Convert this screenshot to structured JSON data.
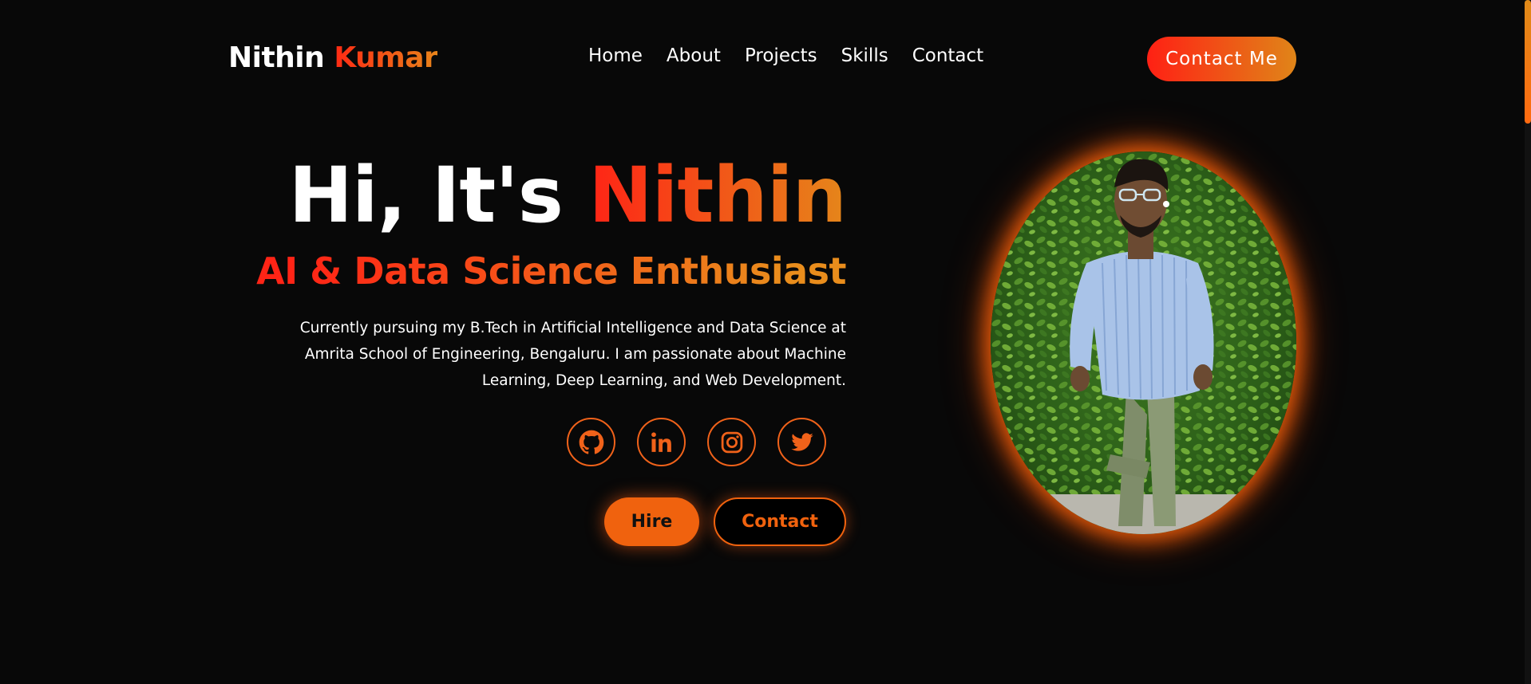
{
  "header": {
    "logo_first": "Nithin",
    "logo_last": "Kumar",
    "nav": [
      "Home",
      "About",
      "Projects",
      "Skills",
      "Contact"
    ],
    "cta_label": "Contact Me"
  },
  "hero": {
    "greeting": "Hi, It's",
    "name": "Nithin",
    "subtitle": "AI & Data Science Enthusiast",
    "description": "Currently pursuing my B.Tech in Artificial Intelligence and Data Science at Amrita School of Engineering, Bengaluru. I am passionate about Machine Learning, Deep Learning, and Web Development.",
    "socials": [
      "github-icon",
      "linkedin-icon",
      "instagram-icon",
      "twitter-icon"
    ],
    "hire_label": "Hire",
    "contact_label": "Contact"
  },
  "theme": {
    "background": "#080808",
    "accent_start": "#ff2416",
    "accent_end": "#e5861a",
    "button_orange": "#f0620e"
  }
}
